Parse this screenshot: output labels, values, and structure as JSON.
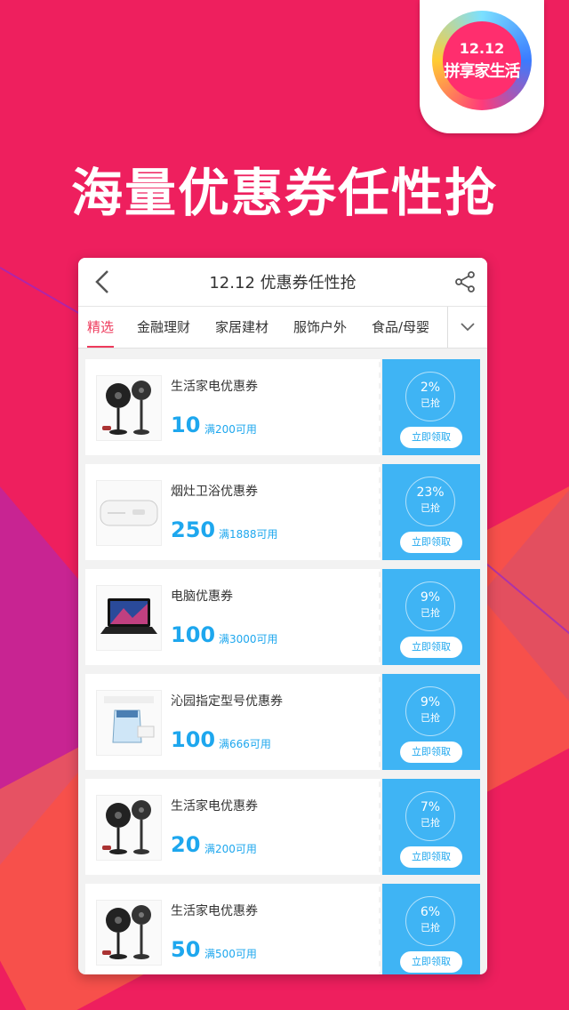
{
  "banner": {
    "logo_line1": "12.12",
    "logo_line2": "拼享家生活",
    "headline": "海量优惠券任性抢"
  },
  "nav": {
    "back_icon": "chevron-left-icon",
    "title": "12.12  优惠券任性抢",
    "share_icon": "share-icon"
  },
  "tabs": {
    "items": [
      {
        "label": "精选",
        "active": true
      },
      {
        "label": "金融理财",
        "active": false
      },
      {
        "label": "家居建材",
        "active": false
      },
      {
        "label": "服饰户外",
        "active": false
      },
      {
        "label": "食品/母婴",
        "active": false
      }
    ],
    "more_icon": "chevron-down-icon"
  },
  "coupons": [
    {
      "name": "生活家电优惠券",
      "amount": "10",
      "condition": "满200可用",
      "percent": "2%",
      "taken": "已抢",
      "button": "立即领取",
      "product": "fan"
    },
    {
      "name": "烟灶卫浴优惠券",
      "amount": "250",
      "condition": "满1888可用",
      "percent": "23%",
      "taken": "已抢",
      "button": "立即领取",
      "product": "water-heater"
    },
    {
      "name": "电脑优惠券",
      "amount": "100",
      "condition": "满3000可用",
      "percent": "9%",
      "taken": "已抢",
      "button": "立即领取",
      "product": "laptop"
    },
    {
      "name": "沁园指定型号优惠券",
      "amount": "100",
      "condition": "满666可用",
      "percent": "9%",
      "taken": "已抢",
      "button": "立即领取",
      "product": "water-purifier"
    },
    {
      "name": "生活家电优惠券",
      "amount": "20",
      "condition": "满200可用",
      "percent": "7%",
      "taken": "已抢",
      "button": "立即领取",
      "product": "fan"
    },
    {
      "name": "生活家电优惠券",
      "amount": "50",
      "condition": "满500可用",
      "percent": "6%",
      "taken": "已抢",
      "button": "立即领取",
      "product": "fan"
    }
  ],
  "colors": {
    "background": "#ee1f5e",
    "accent_blue": "#3fb4f4",
    "amount_blue": "#1ea7ee",
    "active_tab": "#ee3a5c"
  }
}
